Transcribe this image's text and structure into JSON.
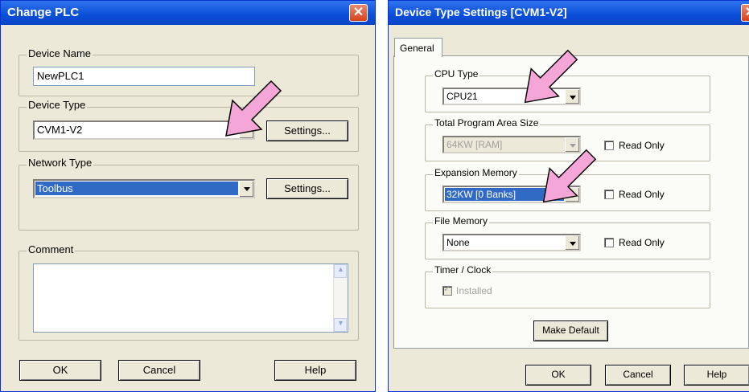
{
  "change_plc": {
    "title": "Change PLC",
    "device_name": {
      "label": "Device Name",
      "value": "NewPLC1"
    },
    "device_type": {
      "label": "Device Type",
      "value": "CVM1-V2",
      "settings_label": "Settings..."
    },
    "network_type": {
      "label": "Network Type",
      "value": "Toolbus",
      "settings_label": "Settings..."
    },
    "comment": {
      "label": "Comment",
      "value": ""
    },
    "buttons": {
      "ok": "OK",
      "cancel": "Cancel",
      "help": "Help"
    }
  },
  "device_type_settings": {
    "title": "Device Type Settings [CVM1-V2]",
    "tab": "General",
    "cpu_type": {
      "label": "CPU Type",
      "value": "CPU21"
    },
    "program_area": {
      "label": "Total Program Area Size",
      "value": "64KW [RAM]",
      "read_only_label": "Read Only"
    },
    "expansion_memory": {
      "label": "Expansion Memory",
      "value": "32KW [0 Banks]",
      "read_only_label": "Read Only"
    },
    "file_memory": {
      "label": "File Memory",
      "value": "None",
      "read_only_label": "Read Only"
    },
    "timer_clock": {
      "label": "Timer / Clock",
      "installed_label": "Installed"
    },
    "make_default": "Make Default",
    "buttons": {
      "ok": "OK",
      "cancel": "Cancel",
      "help": "Help"
    }
  },
  "colors": {
    "title_bar": "#0a4fd8",
    "dialog_bg": "#ece9d8",
    "selection": "#316ac5",
    "annotation_arrow": "#f4a6d8"
  },
  "icons": [
    "close-icon",
    "dropdown-arrow-icon",
    "scroll-up-icon",
    "scroll-down-icon",
    "pink-annotation-arrow"
  ]
}
